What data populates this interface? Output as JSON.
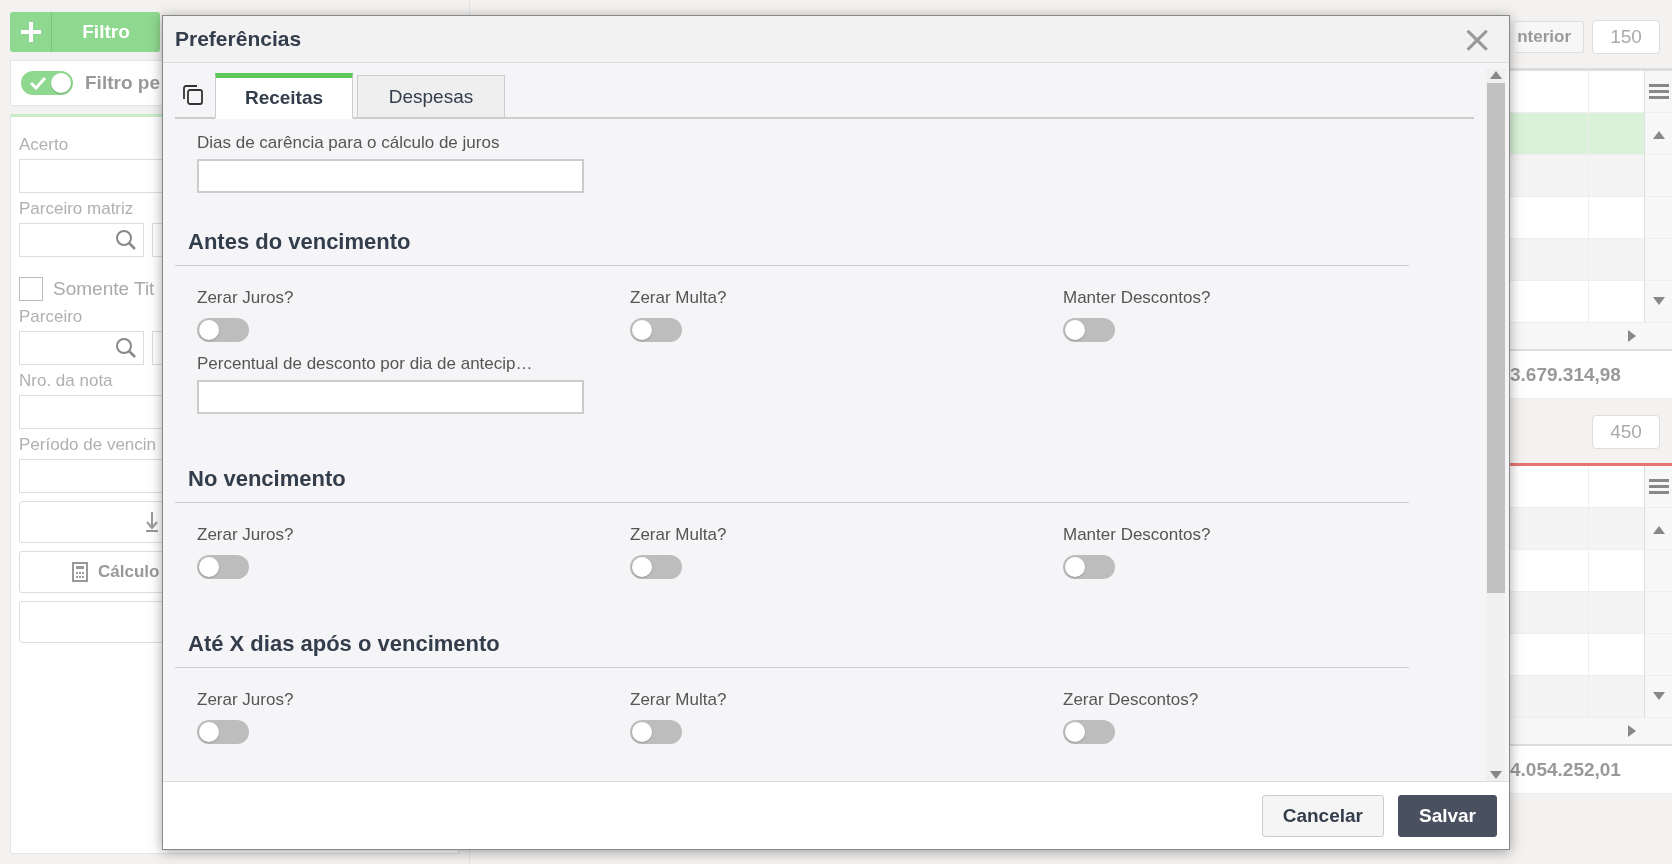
{
  "sidebar": {
    "filter_button": "Filtro",
    "filter_toggle": {
      "label": "Filtro pe",
      "on": true
    },
    "fields": [
      {
        "kind": "input",
        "label": "Acerto"
      },
      {
        "kind": "search",
        "label": "Parceiro matriz"
      },
      {
        "kind": "checkbox",
        "label": "Somente Tit",
        "checked": false
      },
      {
        "kind": "search",
        "label": "Parceiro"
      },
      {
        "kind": "input",
        "label": "Nro. da nota"
      },
      {
        "kind": "input",
        "label": "Período de vencin"
      }
    ],
    "buttons": [
      {
        "kind": "icon_only"
      },
      {
        "kind": "icon_label",
        "label": "Cálculo"
      },
      {
        "kind": "blank"
      }
    ]
  },
  "previous_button": "nterior",
  "grids": [
    {
      "count": "150",
      "color": "#dddddd",
      "rows": [
        {
          "selected": true
        },
        {
          "selected": false
        },
        {
          "selected": false
        },
        {
          "selected": false
        },
        {
          "selected": false
        }
      ],
      "total": "3.679.314,98"
    },
    {
      "count": "450",
      "color": "#e57373",
      "rows": [
        {
          "selected": false
        },
        {
          "selected": false
        },
        {
          "selected": false
        },
        {
          "selected": false
        },
        {
          "selected": false
        }
      ],
      "total": "4.054.252,01"
    }
  ],
  "dialog": {
    "title": "Preferências",
    "close": "×",
    "tabs": [
      {
        "label": "Receitas",
        "selected": true
      },
      {
        "label": "Despesas",
        "selected": false
      }
    ],
    "top_fields": [
      {
        "kind": "input",
        "label": "Dias de carência para o cálculo de juros"
      }
    ],
    "sections": [
      {
        "title": "Antes do vencimento",
        "fields": [
          {
            "kind": "toggle",
            "label": "Zerar Juros?",
            "on": false
          },
          {
            "kind": "toggle",
            "label": "Zerar Multa?",
            "on": false
          },
          {
            "kind": "toggle",
            "label": "Manter Descontos?",
            "on": false
          },
          {
            "kind": "input",
            "label": "Percentual de desconto por dia de antecip…"
          }
        ]
      },
      {
        "title": "No vencimento",
        "fields": [
          {
            "kind": "toggle",
            "label": "Zerar Juros?",
            "on": false
          },
          {
            "kind": "toggle",
            "label": "Zerar Multa?",
            "on": false
          },
          {
            "kind": "toggle",
            "label": "Manter Descontos?",
            "on": false
          }
        ]
      },
      {
        "title": "Até X dias após o vencimento",
        "fields": [
          {
            "kind": "toggle",
            "label": "Zerar Juros?",
            "on": false
          },
          {
            "kind": "toggle",
            "label": "Zerar Multa?",
            "on": false
          },
          {
            "kind": "toggle",
            "label": "Zerar Descontos?",
            "on": false
          }
        ]
      }
    ],
    "buttons": [
      {
        "kind": "secondary",
        "label": "Cancelar"
      },
      {
        "kind": "primary",
        "label": "Salvar"
      }
    ]
  }
}
